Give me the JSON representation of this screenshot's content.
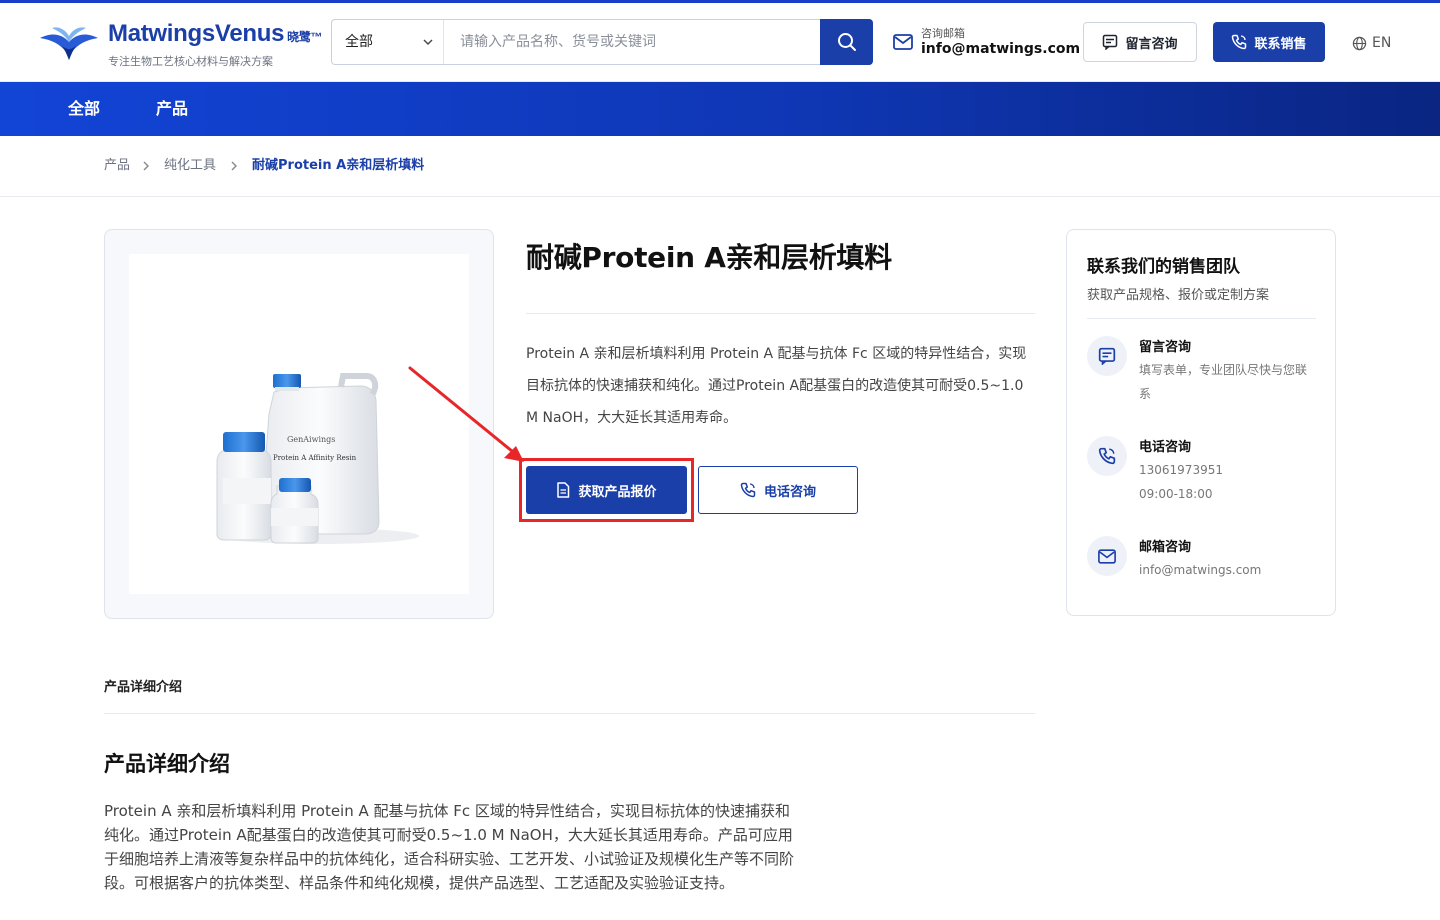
{
  "header": {
    "brand": "MatwingsVenus",
    "brand_cn": "晓鹭™",
    "tagline": "专注生物工艺核心材料与解决方案",
    "search_category": "全部",
    "search_placeholder": "请输入产品名称、货号或关键词",
    "mail_label": "咨询邮箱",
    "mail_address": "info@matwings.com",
    "message_button": "留言咨询",
    "sales_button": "联系销售",
    "language": "EN"
  },
  "nav": {
    "items": [
      {
        "label": "全部"
      },
      {
        "label": "产品"
      }
    ]
  },
  "breadcrumb": {
    "items": [
      "产品",
      "纯化工具",
      "耐碱Protein A亲和层析填料"
    ]
  },
  "product": {
    "title": "耐碱Protein A亲和层析填料",
    "description": "Protein A 亲和层析填料利用 Protein A 配基与抗体 Fc 区域的特异性结合，实现目标抗体的快速捕获和纯化。通过Protein A配基蛋白的改造使其可耐受0.5~1.0 M NaOH，大大延长其适用寿命。",
    "quote_button": "获取产品报价",
    "phone_button": "电话咨询",
    "image_labels": [
      "GenAiwings",
      "Protein A Affinity Resin"
    ]
  },
  "sales_card": {
    "title": "联系我们的销售团队",
    "subtitle": "获取产品规格、报价或定制方案",
    "items": [
      {
        "icon": "message-icon",
        "title": "留言咨询",
        "text": "填写表单，专业团队尽快与您联系"
      },
      {
        "icon": "phone-icon",
        "title": "电话咨询",
        "text": "13061973951",
        "text2": "09:00-18:00"
      },
      {
        "icon": "mail-icon",
        "title": "邮箱咨询",
        "text": "info@matwings.com"
      }
    ]
  },
  "details": {
    "tab_label": "产品详细介绍",
    "title": "产品详细介绍",
    "text": "Protein A 亲和层析填料利用 Protein A 配基与抗体 Fc 区域的特异性结合，实现目标抗体的快速捕获和纯化。通过Protein A配基蛋白的改造使其可耐受0.5~1.0 M NaOH，大大延长其适用寿命。产品可应用于细胞培养上清液等复杂样品中的抗体纯化，适合科研实验、工艺开发、小试验证及规模化生产等不同阶段。可根据客户的抗体类型、样品条件和纯化规模，提供产品选型、工艺适配及实验验证支持。"
  },
  "colors": {
    "primary": "#1b3fa8",
    "highlight": "#e8262a",
    "nav_gradient_start": "#1244d6",
    "nav_gradient_end": "#0a2582"
  }
}
